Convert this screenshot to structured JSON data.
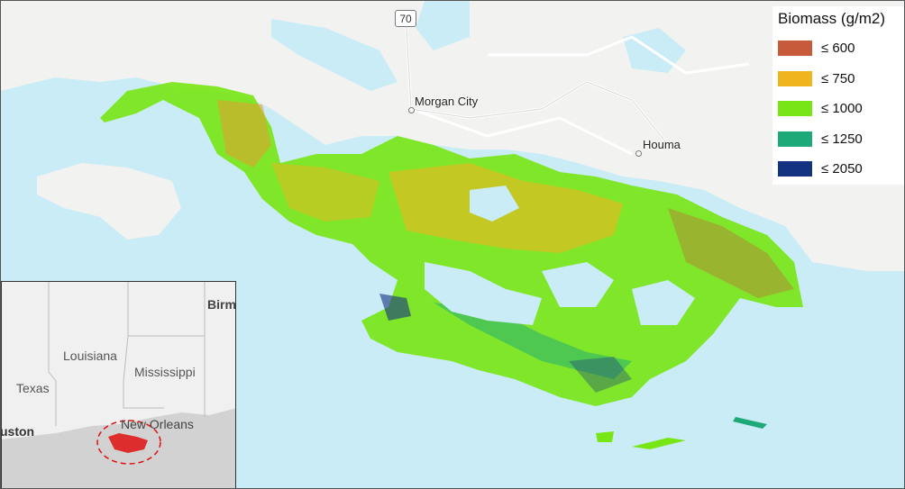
{
  "map": {
    "places": {
      "morgan_city": "Morgan City",
      "houma": "Houma",
      "route": "70"
    },
    "legend": {
      "title": "Biomass (g/m2)",
      "items": [
        {
          "label": "≤ 600",
          "color": "#c85a3c"
        },
        {
          "label": "≤ 750",
          "color": "#f0b41e"
        },
        {
          "label": "≤ 1000",
          "color": "#78e614"
        },
        {
          "label": "≤ 1250",
          "color": "#1eaa78"
        },
        {
          "label": "≤ 2050",
          "color": "#143282"
        }
      ]
    },
    "inset": {
      "labels": {
        "louisiana": "Louisiana",
        "mississippi": "Mississippi",
        "texas": "Texas",
        "new_orleans": "New Orleans",
        "houston": "uston",
        "birmingham": "Birm"
      }
    },
    "colors": {
      "water": "#c9ecf6",
      "land": "#f2f2f0",
      "inset_land": "#f0f0f0",
      "inset_gulf": "#d2d2d2",
      "highlight": "#e01010"
    }
  }
}
